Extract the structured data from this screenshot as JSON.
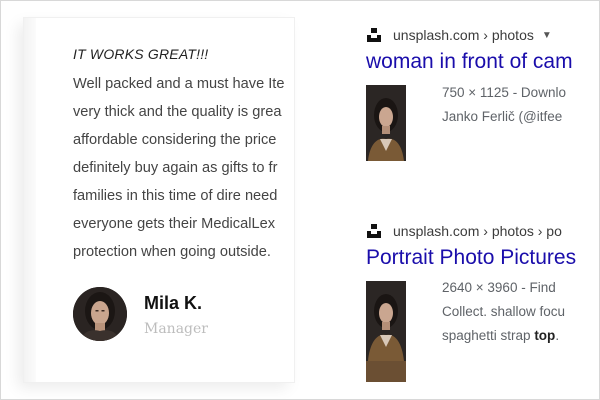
{
  "review": {
    "title": "IT WORKS GREAT!!!",
    "lines": [
      "Well packed and a must have Ite",
      "very thick and the quality is grea",
      "affordable considering the price",
      "definitely buy again as gifts to fr",
      "families in this time of dire need",
      "everyone gets their MedicalLex",
      "protection when going outside."
    ],
    "author_name": "Mila K.",
    "author_role": "Manager"
  },
  "results": [
    {
      "site": "unsplash.com › photos",
      "has_caret": true,
      "title": "woman in front of cam",
      "snippet_lines": [
        "750 × 1125 - Downlo",
        "Janko Ferlič (@itfee"
      ]
    },
    {
      "site": "unsplash.com › photos › po",
      "has_caret": false,
      "title": "Portrait Photo Pictures",
      "snippet_lines": [
        "2640 × 3960 - Find",
        "Collect. shallow focu"
      ],
      "snippet_line3_prefix": "spaghetti strap ",
      "snippet_line3_bold": "top",
      "snippet_line3_suffix": "."
    }
  ],
  "icons": {
    "site_favicon": "unsplash-icon",
    "dropdown": "caret-down-icon"
  },
  "colors": {
    "link": "#1a0dab",
    "body_text": "#444444",
    "muted": "#5f6368",
    "role_text": "#bdbdbd"
  }
}
